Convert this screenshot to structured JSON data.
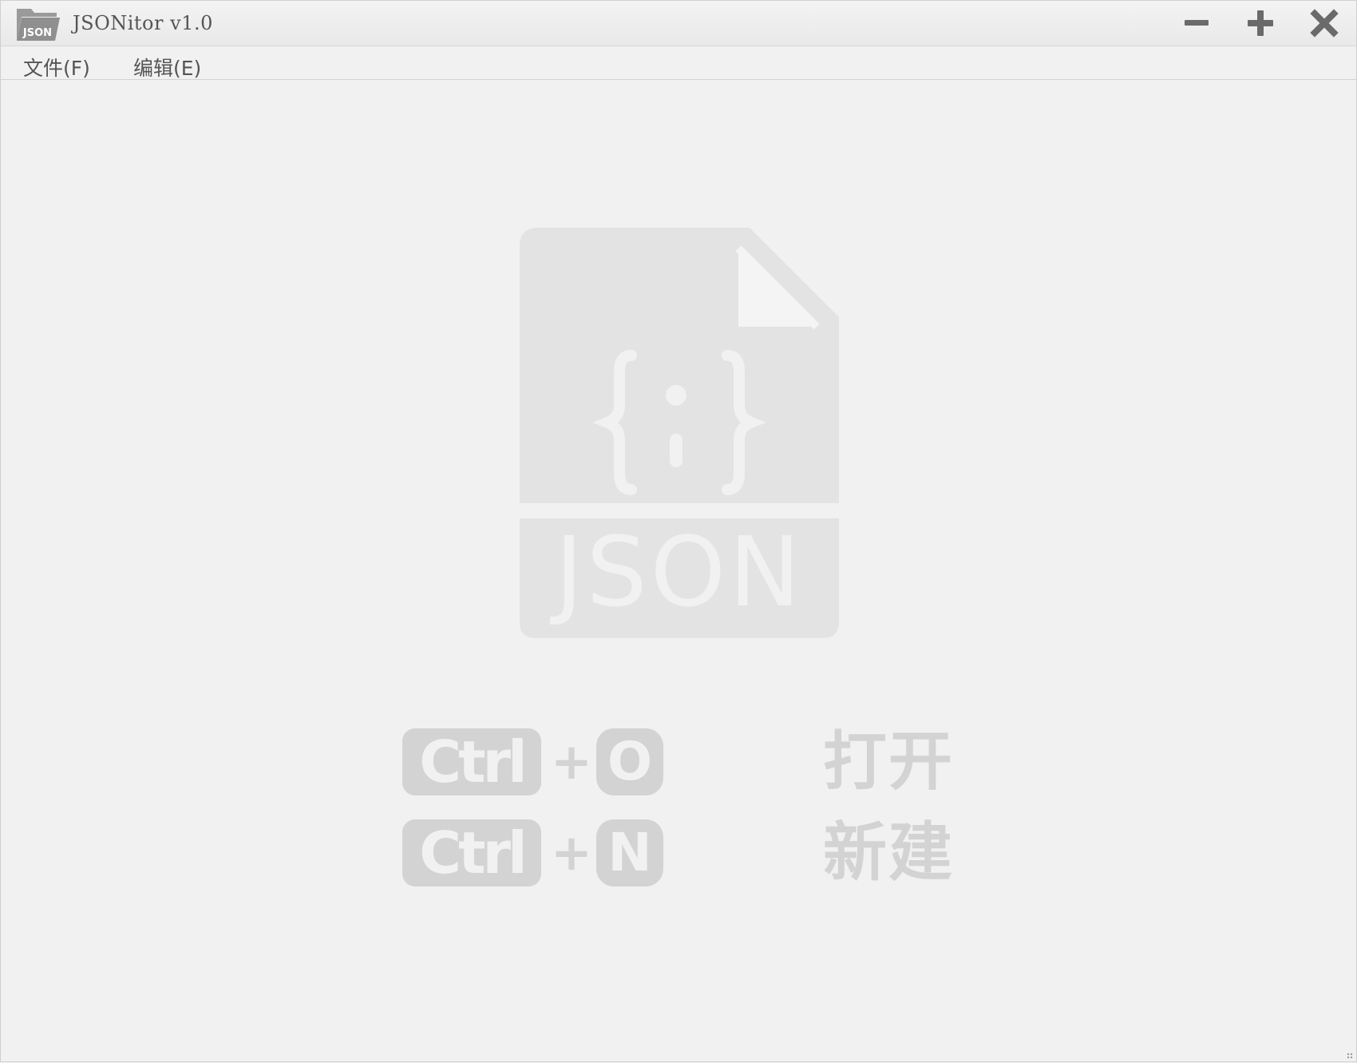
{
  "window": {
    "title": "JSONitor v1.0",
    "app_icon_text": "JSON",
    "app_icon": "folder-json-icon",
    "controls": {
      "minimize": "minus-icon",
      "maximize": "plus-icon",
      "close": "close-icon"
    }
  },
  "menubar": {
    "items": [
      {
        "label": "文件(F)"
      },
      {
        "label": "编辑(E)"
      }
    ]
  },
  "placeholder": {
    "document_icon": "json-file-icon",
    "document_label": "JSON",
    "shortcuts": [
      {
        "modifier": "Ctrl",
        "plus": "+",
        "key": "O",
        "action": "打开"
      },
      {
        "modifier": "Ctrl",
        "plus": "+",
        "key": "N",
        "action": "新建"
      }
    ]
  },
  "colors": {
    "background": "#f1f1f1",
    "watermark": "#d3d3d3",
    "doc_fill": "#e3e3e3",
    "text": "#555555"
  }
}
